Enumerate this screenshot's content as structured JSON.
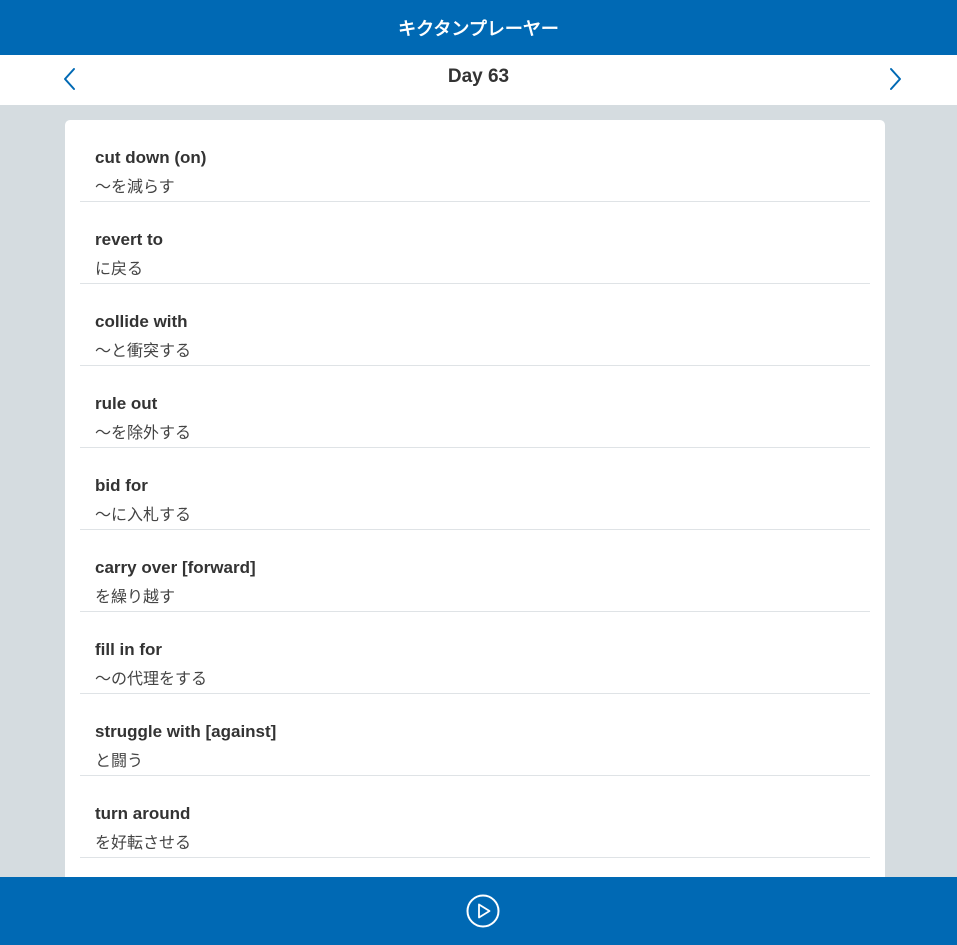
{
  "header": {
    "title": "キクタンプレーヤー"
  },
  "nav": {
    "day_label": "Day 63",
    "prev_icon": "chevron-left-icon",
    "next_icon": "chevron-right-icon"
  },
  "words": [
    {
      "en": "cut down (on)",
      "ja": "～を減らす"
    },
    {
      "en": "revert to",
      "ja": "に戻る"
    },
    {
      "en": "collide with",
      "ja": "～と衝突する"
    },
    {
      "en": "rule out",
      "ja": "～を除外する"
    },
    {
      "en": "bid for",
      "ja": "～に入札する"
    },
    {
      "en": "carry over [forward]",
      "ja": "を繰り越す"
    },
    {
      "en": "fill in for",
      "ja": "～の代理をする"
    },
    {
      "en": "struggle with [against]",
      "ja": "と闘う"
    },
    {
      "en": "turn around",
      "ja": "を好転させる"
    }
  ],
  "footer": {
    "play_icon": "play-circle-icon"
  },
  "colors": {
    "brand": "#0069b4",
    "background": "#d5dce0",
    "card": "#ffffff",
    "text": "#333333"
  }
}
